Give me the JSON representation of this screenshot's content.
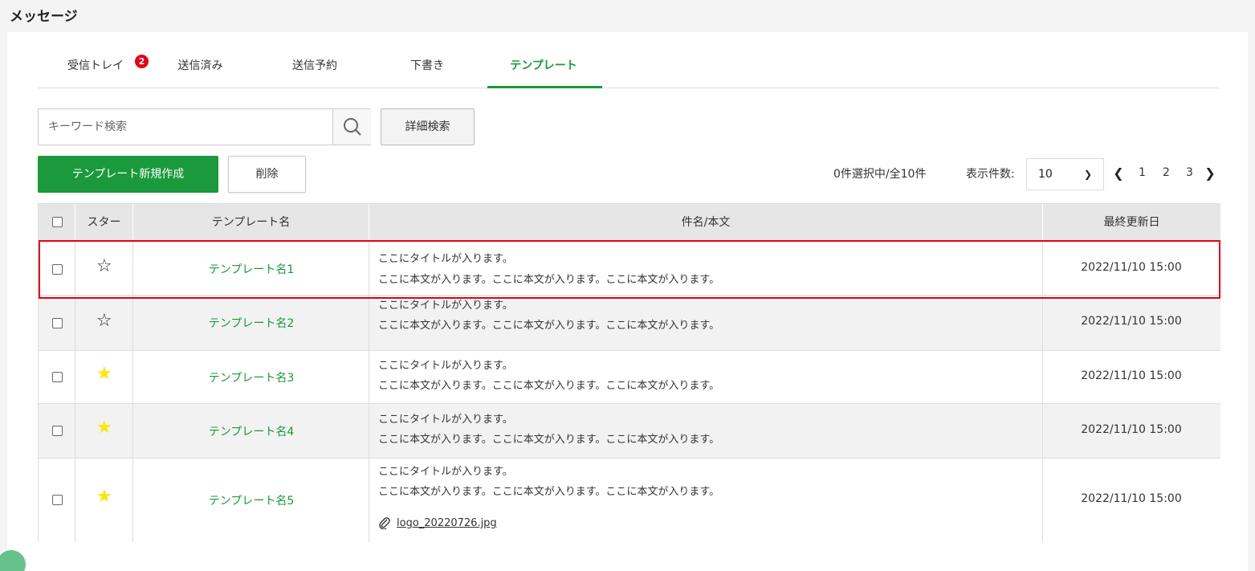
{
  "page": {
    "title": "メッセージ"
  },
  "tabs": [
    {
      "label": "受信トレイ",
      "active": false
    },
    {
      "label": "送信済み",
      "active": false
    },
    {
      "label": "送信予約",
      "active": false
    },
    {
      "label": "下書き",
      "active": false
    },
    {
      "label": "テンプレート",
      "active": true
    }
  ],
  "inbox_badge": "2",
  "search": {
    "placeholder": "キーワード検索",
    "value": "",
    "icon": "search-icon"
  },
  "toolbar": {
    "detail_search_label": "詳細検索",
    "new_template_label": "テンプレート新規作成",
    "delete_label": "削除"
  },
  "selection_status": "0件選択中/全10件",
  "per_page": {
    "label": "表示件数:",
    "value": "10"
  },
  "pagination": {
    "pages": [
      "1",
      "2",
      "3"
    ],
    "prev_icon": "chevron-left-icon",
    "next_icon": "chevron-right-icon"
  },
  "table": {
    "headers": {
      "star": "スター",
      "name": "テンプレート名",
      "subject_body": "件名/本文",
      "updated": "最終更新日"
    },
    "rows": [
      {
        "starred": false,
        "name": "テンプレート名1",
        "subject": "ここにタイトルが入ります。",
        "body": "ここに本文が入ります。ここに本文が入ります。ここに本文が入ります。",
        "attachment": "",
        "updated": "2022/11/10 15:00",
        "highlighted": true
      },
      {
        "starred": false,
        "name": "テンプレート名2",
        "subject": "ここにタイトルが入ります。",
        "body": "ここに本文が入ります。ここに本文が入ります。ここに本文が入ります。",
        "attachment": "",
        "updated": "2022/11/10 15:00"
      },
      {
        "starred": true,
        "name": "テンプレート名3",
        "subject": "ここにタイトルが入ります。",
        "body": "ここに本文が入ります。ここに本文が入ります。ここに本文が入ります。",
        "attachment": "",
        "updated": "2022/11/10 15:00"
      },
      {
        "starred": true,
        "name": "テンプレート名4",
        "subject": "ここにタイトルが入ります。",
        "body": "ここに本文が入ります。ここに本文が入ります。ここに本文が入ります。",
        "attachment": "",
        "updated": "2022/11/10 15:00"
      },
      {
        "starred": true,
        "name": "テンプレート名5",
        "subject": "ここにタイトルが入ります。",
        "body": "ここに本文が入ります。ここに本文が入ります。ここに本文が入ります。",
        "attachment": "logo_20220726.jpg",
        "updated": "2022/11/10 15:00"
      }
    ]
  },
  "colors": {
    "accent": "#1a9a3c",
    "badge": "#e60012",
    "star_on": "#ffe600",
    "highlight": "#e60012"
  }
}
